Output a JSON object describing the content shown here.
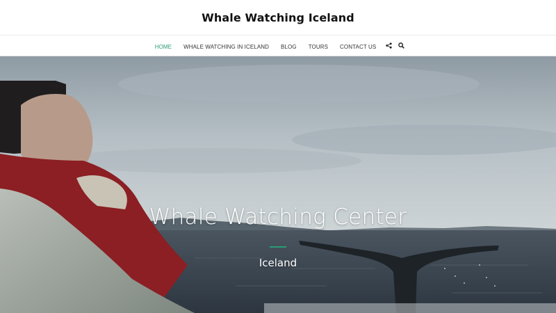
{
  "site": {
    "title": "Whale Watching Iceland"
  },
  "nav": {
    "items": [
      {
        "label": "HOME",
        "active": true
      },
      {
        "label": "WHALE WATCHING IN ICELAND",
        "active": false
      },
      {
        "label": "BLOG",
        "active": false
      },
      {
        "label": "TOURS",
        "active": false
      },
      {
        "label": "CONTACT US",
        "active": false
      }
    ],
    "icons": [
      "share-icon",
      "search-icon"
    ]
  },
  "hero": {
    "title": "Whale Watching Center",
    "subtitle": "Iceland",
    "image": "whale-tail-photo"
  },
  "colors": {
    "accent": "#2a9d74",
    "title_text": "#111111",
    "nav_text": "#333333"
  }
}
